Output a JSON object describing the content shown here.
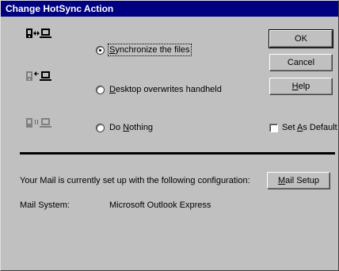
{
  "window": {
    "title": "Change HotSync Action"
  },
  "options": [
    {
      "prefix": "",
      "hotkey": "S",
      "rest": "ynchronize the files",
      "selected": true,
      "icon": "sync-both-icon"
    },
    {
      "prefix": "",
      "hotkey": "D",
      "rest": "esktop overwrites handheld",
      "selected": false,
      "icon": "desktop-to-handheld-icon"
    },
    {
      "prefix": "Do ",
      "hotkey": "N",
      "rest": "othing",
      "selected": false,
      "icon": "do-nothing-icon"
    }
  ],
  "buttons": {
    "ok": "OK",
    "cancel": "Cancel",
    "help_hotkey": "H",
    "help_rest": "elp",
    "mail_hotkey": "M",
    "mail_rest": "ail Setup"
  },
  "set_default": {
    "prefix": "Set ",
    "hotkey": "A",
    "rest": "s Default",
    "checked": false
  },
  "mail": {
    "config_text": "Your Mail is currently set up with the following configuration:",
    "system_label": "Mail System:",
    "system_value": "Microsoft Outlook Express"
  },
  "colors": {
    "face": "#c0c0c0",
    "titlebar": "#000080",
    "title_text": "#ffffff"
  }
}
